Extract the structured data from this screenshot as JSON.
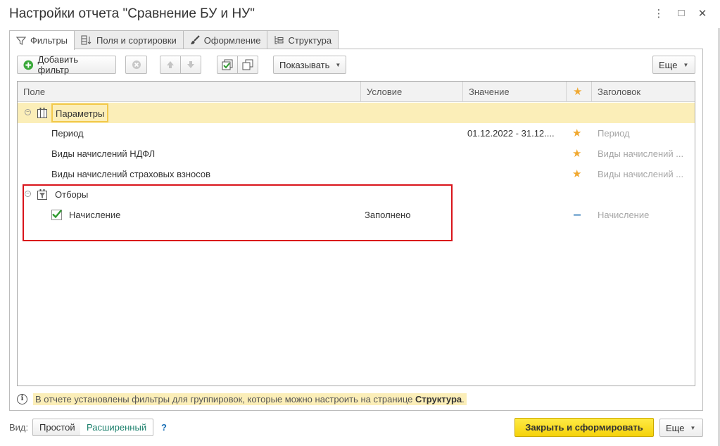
{
  "window": {
    "title": "Настройки отчета \"Сравнение БУ и НУ\"",
    "controls": [
      "⋮",
      "□",
      "✕"
    ]
  },
  "tabs": [
    {
      "label": "Фильтры",
      "icon": "funnel-icon",
      "active": true
    },
    {
      "label": "Поля и сортировки",
      "icon": "fields-sort-icon",
      "active": false
    },
    {
      "label": "Оформление",
      "icon": "brush-icon",
      "active": false
    },
    {
      "label": "Структура",
      "icon": "structure-icon",
      "active": false
    }
  ],
  "toolbar": {
    "add_filter_label": "Добавить фильтр",
    "show_label": "Показывать",
    "more_label": "Еще"
  },
  "table": {
    "headers": {
      "field": "Поле",
      "condition": "Условие",
      "value": "Значение",
      "star": "★",
      "caption": "Заголовок"
    },
    "rows": [
      {
        "type": "group",
        "label": "Параметры"
      },
      {
        "type": "item",
        "label": "Период",
        "condition": "",
        "value": "01.12.2022 - 31.12....",
        "starred": true,
        "caption": "Период"
      },
      {
        "type": "item",
        "label": "Виды начислений НДФЛ",
        "condition": "",
        "value": "",
        "starred": true,
        "caption": "Виды начислений ..."
      },
      {
        "type": "item",
        "label": "Виды начислений страховых взносов",
        "condition": "",
        "value": "",
        "starred": true,
        "caption": "Виды начислений ..."
      },
      {
        "type": "group",
        "label": "Отборы"
      },
      {
        "type": "filter",
        "label": "Начисление",
        "checked": true,
        "condition": "Заполнено",
        "value": "",
        "starred": false,
        "caption": "Начисление"
      }
    ]
  },
  "info": {
    "text_before": "В отчете установлены фильтры для группировок, которые можно настроить на странице ",
    "link": "Структура",
    "text_after": "."
  },
  "footer": {
    "view_label": "Вид:",
    "simple_label": "Простой",
    "advanced_label": "Расширенный",
    "help_label": "?",
    "primary_label": "Закрыть и сформировать",
    "more_label": "Еще"
  },
  "colors": {
    "accent_yellow": "#f5d20a",
    "selection": "#fbeeb8",
    "highlight_red": "#d9141b",
    "star": "#f0a830",
    "link_green": "#1a7f6b"
  }
}
